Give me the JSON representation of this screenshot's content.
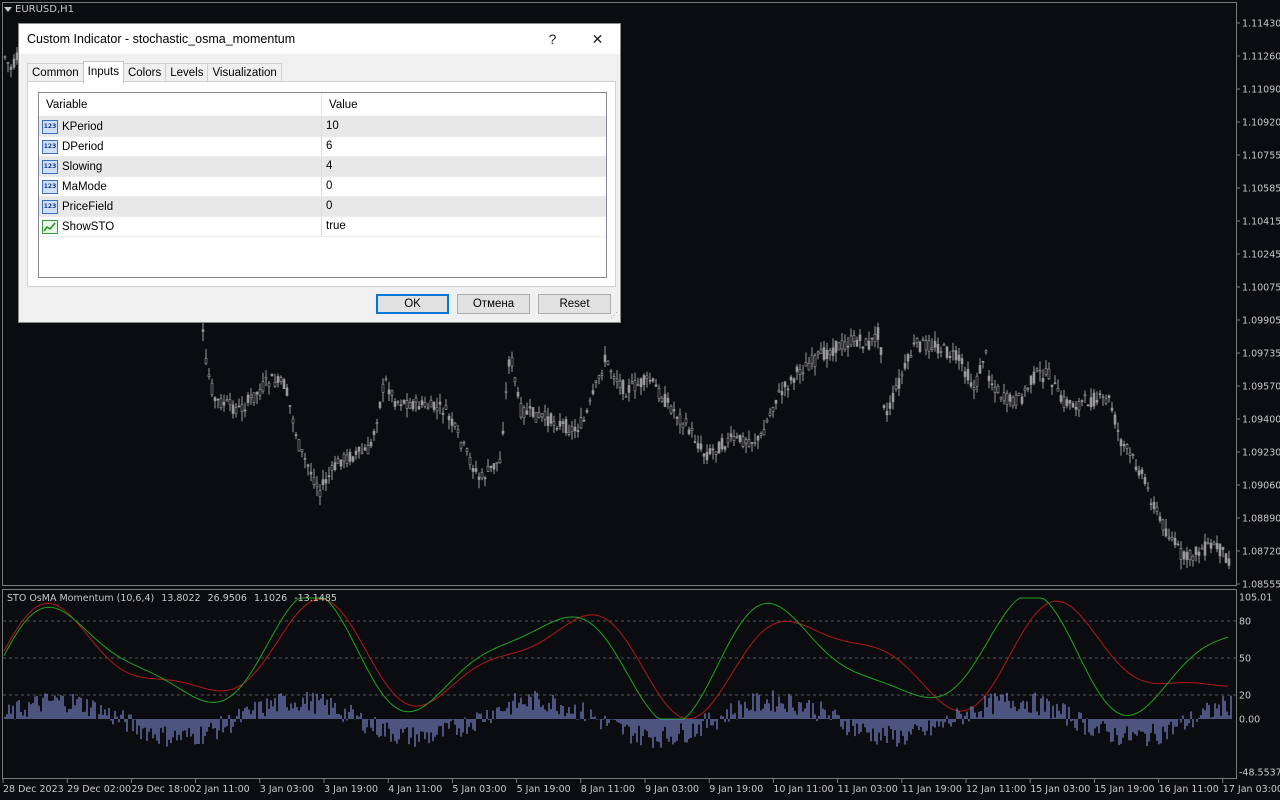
{
  "chart": {
    "symbol_label": "EURUSD,H1",
    "price_axis": [
      "1.11430",
      "1.11260",
      "1.11090",
      "1.10920",
      "1.10755",
      "1.10585",
      "1.10415",
      "1.10245",
      "1.10075",
      "1.09905",
      "1.09735",
      "1.09570",
      "1.09400",
      "1.09230",
      "1.09060",
      "1.08890",
      "1.08720",
      "1.08555"
    ],
    "time_axis": [
      "28 Dec 2023",
      "29 Dec 02:00",
      "29 Dec 18:00",
      "2 Jan 11:00",
      "3 Jan 03:00",
      "3 Jan 19:00",
      "4 Jan 11:00",
      "5 Jan 03:00",
      "5 Jan 19:00",
      "8 Jan 11:00",
      "9 Jan 03:00",
      "9 Jan 19:00",
      "10 Jan 11:00",
      "11 Jan 03:00",
      "11 Jan 19:00",
      "12 Jan 11:00",
      "15 Jan 03:00",
      "15 Jan 19:00",
      "16 Jan 11:00",
      "17 Jan 03:00"
    ],
    "colors": {
      "background": "#0b0c10",
      "candle": "#9a9a9a",
      "axis_text": "#c8c8c8",
      "k_line": "#1fa41f",
      "d_line": "#b01818",
      "histogram": "#8f9cf0",
      "level_line": "#555555"
    }
  },
  "indicator_panel": {
    "name": "STO OsMA Momentum (10,6,4)",
    "values": [
      "13.8022",
      "26.9506",
      "1.1026",
      "-13.1485"
    ],
    "axis": [
      "105.01",
      "80",
      "50",
      "20",
      "0.00",
      "-48.5537"
    ]
  },
  "dialog": {
    "title": "Custom Indicator - stochastic_osma_momentum",
    "help_label": "?",
    "close_label": "✕",
    "tabs": [
      {
        "label": "Common"
      },
      {
        "label": "Inputs"
      },
      {
        "label": "Colors"
      },
      {
        "label": "Levels"
      },
      {
        "label": "Visualization"
      }
    ],
    "active_tab": "Inputs",
    "grid": {
      "col_variable": "Variable",
      "col_value": "Value",
      "rows": [
        {
          "icon": "123-icon",
          "variable": "KPeriod",
          "value": "10"
        },
        {
          "icon": "123-icon",
          "variable": "DPeriod",
          "value": "6"
        },
        {
          "icon": "123-icon",
          "variable": "Slowing",
          "value": "4"
        },
        {
          "icon": "123-icon",
          "variable": "MaMode",
          "value": "0"
        },
        {
          "icon": "123-icon",
          "variable": "PriceField",
          "value": "0"
        },
        {
          "icon": "bool-icon",
          "variable": "ShowSTO",
          "value": "true"
        }
      ]
    },
    "buttons": {
      "ok": "OK",
      "cancel": "Отмена",
      "reset": "Reset"
    }
  }
}
